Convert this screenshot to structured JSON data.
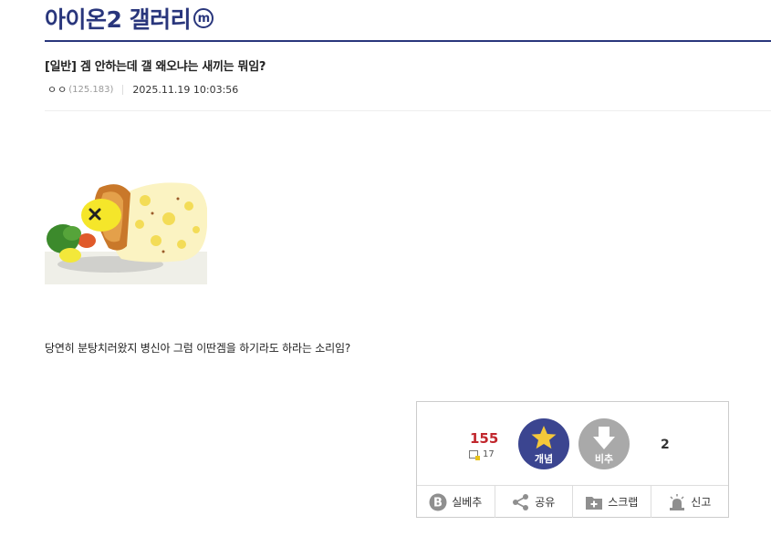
{
  "gallery": {
    "title": "아이온2 갤러리",
    "badge": "m"
  },
  "post": {
    "title": "[일반] 겜 안하는데 갤 왜오냐는 새끼는 뭐임?",
    "author_nick": "ㅇㅇ",
    "author_ip": "(125.183)",
    "datetime": "2025.11.19 10:03:56",
    "body": "당연히 분탕치러왔지 병신아 그럼 이딴겜을 하기라도 하라는 소리임?"
  },
  "vote": {
    "up_count": "155",
    "fixed_count": "17",
    "up_label": "개념",
    "down_label": "비추",
    "down_count": "2"
  },
  "actions": {
    "realtime_label": "실베추",
    "share_label": "공유",
    "scrap_label": "스크랩",
    "report_label": "신고"
  },
  "colors": {
    "brand": "#29367c",
    "up_button": "#3b4590",
    "down_button": "#a9a9a9",
    "up_count": "#c1272d"
  },
  "icons": [
    "minor-gallery-badge-icon",
    "star-icon",
    "down-arrow-icon",
    "b-badge-icon",
    "share-icon",
    "scrap-plus-icon",
    "siren-icon"
  ]
}
